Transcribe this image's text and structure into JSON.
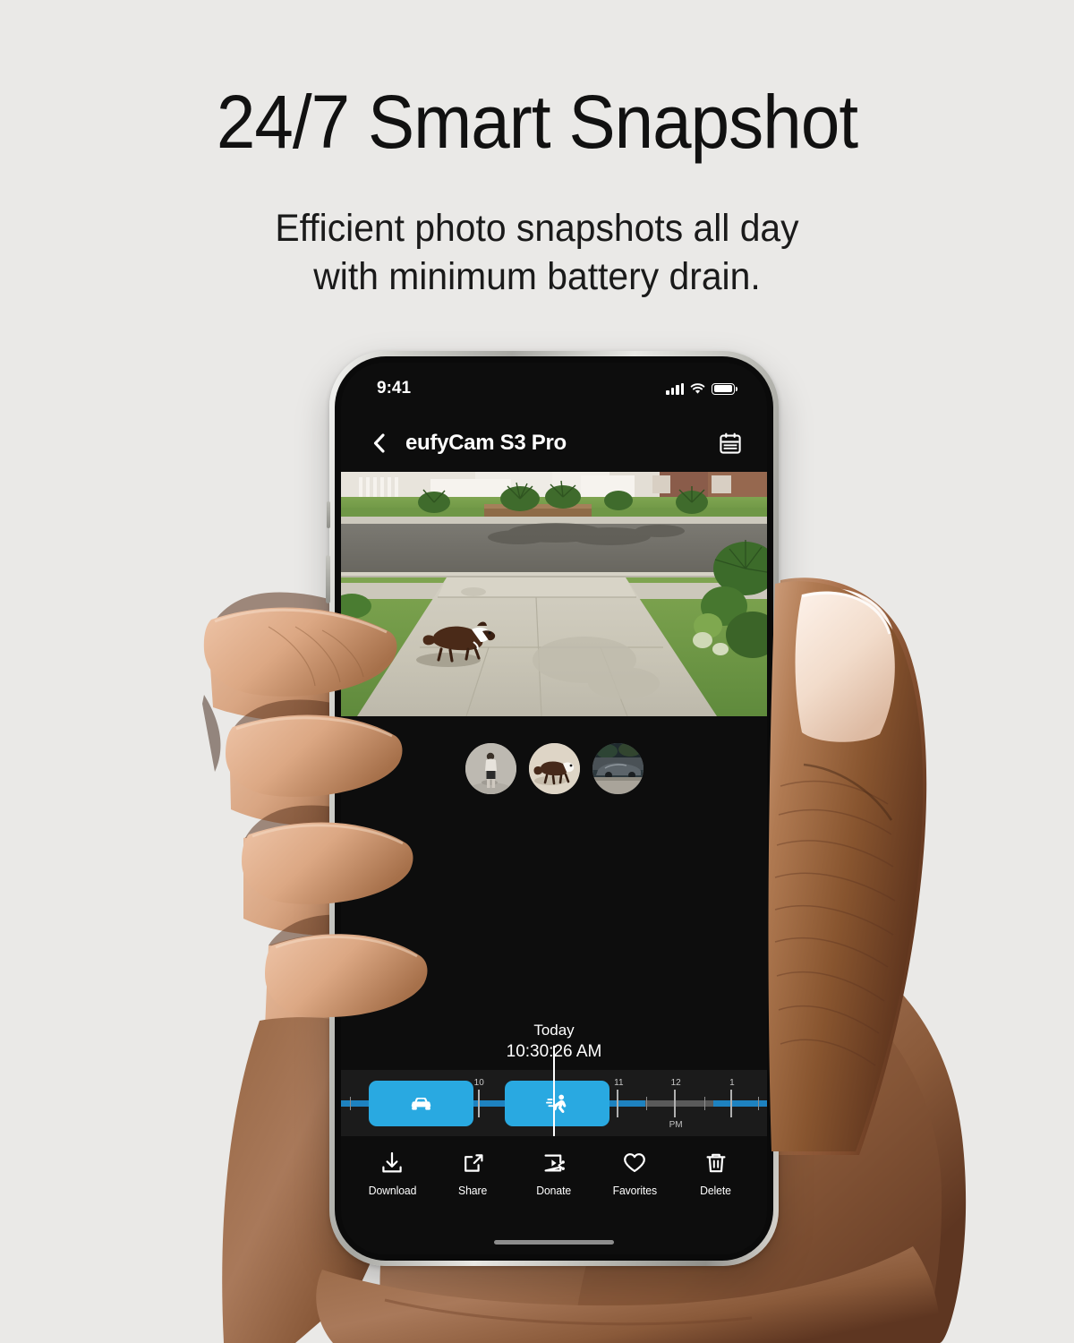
{
  "marketing": {
    "headline": "24/7 Smart Snapshot",
    "subhead_line1": "Efficient photo snapshots all day",
    "subhead_line2": "with minimum battery drain."
  },
  "theme": {
    "page_background": "#EAE9E7",
    "screen_background": "#0D0D0D",
    "accent_blue": "#29A9E1",
    "track_blue": "#1E82C0",
    "track_gray": "#5A5A5A",
    "text_white": "#FFFFFF"
  },
  "phone": {
    "status_bar": {
      "time": "9:41",
      "cellular_icon": "signal-bars-icon",
      "wifi_icon": "wifi-icon",
      "battery_icon": "battery-full-icon"
    },
    "nav_bar": {
      "back_icon": "chevron-left-icon",
      "title": "eufyCam S3 Pro",
      "calendar_icon": "calendar-icon"
    },
    "camera_view": {
      "description": "driveway-snapshot",
      "detected_subject": "dog"
    },
    "thumbnails": [
      {
        "name": "thumbnail-person",
        "subject": "person-walking"
      },
      {
        "name": "thumbnail-dog",
        "subject": "dog-walking"
      },
      {
        "name": "thumbnail-vehicle",
        "subject": "car-on-street"
      }
    ],
    "timestamp": {
      "day": "Today",
      "time": "10:30:26 AM"
    },
    "timeline": {
      "hour_labels": [
        "10",
        "11",
        "12",
        "1"
      ],
      "meridiem_label": "PM",
      "events": [
        {
          "name": "timeline-event-vehicle",
          "icon": "car-icon",
          "start_pct": 6.5,
          "width_pct": 24.5
        },
        {
          "name": "timeline-event-person",
          "icon": "running-person-icon",
          "start_pct": 38.5,
          "width_pct": 24.5
        }
      ],
      "playhead_pct": 50.0,
      "gap_start_pct": 71.5,
      "gap_width_pct": 16.0
    },
    "action_bar": [
      {
        "label": "Download",
        "icon": "download-icon"
      },
      {
        "label": "Share",
        "icon": "share-icon"
      },
      {
        "label": "Donate",
        "icon": "donate-video-icon"
      },
      {
        "label": "Favorites",
        "icon": "heart-icon"
      },
      {
        "label": "Delete",
        "icon": "trash-icon"
      }
    ],
    "home_indicator": "home-indicator"
  }
}
